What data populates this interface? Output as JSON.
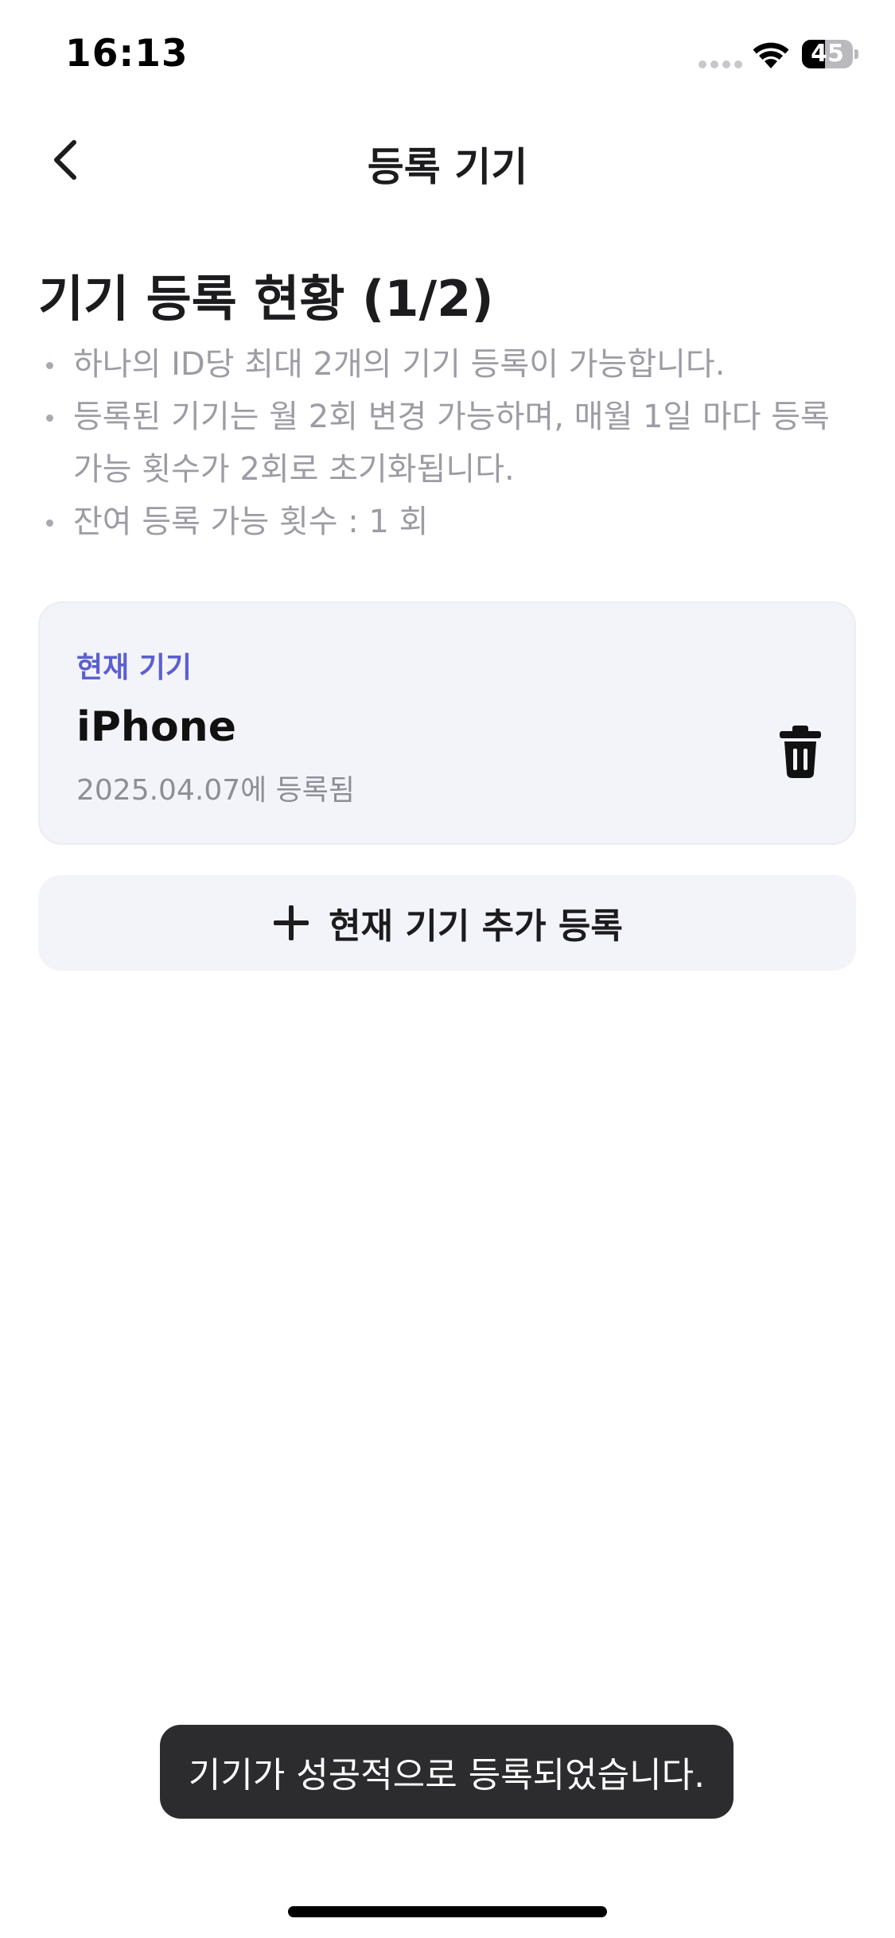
{
  "status_bar": {
    "time": "16:13",
    "battery_level": "45",
    "battery_fraction": 0.45
  },
  "nav": {
    "title": "등록 기기",
    "back_icon": "chevron-left-icon"
  },
  "registration": {
    "title": "기기 등록 현황 (1/2)",
    "notices": [
      "하나의 ID당 최대 2개의 기기 등록이 가능합니다.",
      "등록된 기기는 월 2회 변경 가능하며, 매월 1일 마다 등록 가능 횟수가 2회로 초기화됩니다.",
      "잔여 등록 가능 횟수 : 1 회"
    ]
  },
  "device": {
    "label": "현재 기기",
    "name": "iPhone",
    "registered_date": "2025.04.07에 등록됨",
    "delete_icon": "trash-icon"
  },
  "add_button": {
    "label": "현재 기기 추가 등록",
    "icon": "plus-icon"
  },
  "toast": {
    "message": "기기가 성공적으로 등록되었습니다."
  },
  "colors": {
    "accent": "#5b5fcf",
    "card_bg": "#f3f3fa",
    "toast_bg": "#2c2c2e",
    "muted_text": "#9c9ca4"
  }
}
